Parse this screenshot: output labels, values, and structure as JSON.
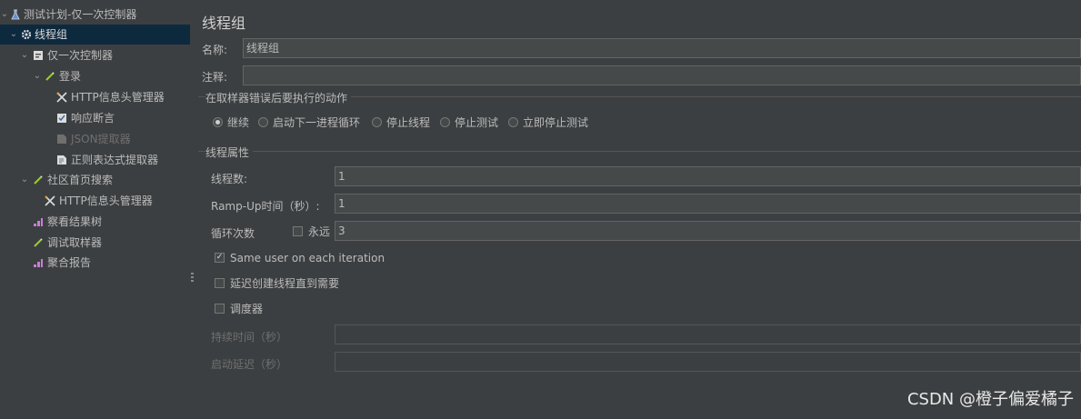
{
  "tree": {
    "items": [
      {
        "label": "测试计划-仅一次控制器",
        "icon": "flask-icon"
      },
      {
        "label": "线程组",
        "icon": "gear-icon"
      },
      {
        "label": "仅一次控制器",
        "icon": "controller-icon"
      },
      {
        "label": "登录",
        "icon": "sampler-pen-icon"
      },
      {
        "label": "HTTP信息头管理器",
        "icon": "wrench-icon"
      },
      {
        "label": "响应断言",
        "icon": "assertion-icon"
      },
      {
        "label": "JSON提取器",
        "icon": "extractor-icon"
      },
      {
        "label": "正则表达式提取器",
        "icon": "regex-extractor-icon"
      },
      {
        "label": "社区首页搜索",
        "icon": "sampler-pen-icon"
      },
      {
        "label": "HTTP信息头管理器",
        "icon": "wrench-icon"
      },
      {
        "label": "察看结果树",
        "icon": "listener-chart-icon"
      },
      {
        "label": "调试取样器",
        "icon": "sampler-pen-icon"
      },
      {
        "label": "聚合报告",
        "icon": "listener-chart-icon"
      }
    ]
  },
  "panel": {
    "title": "线程组",
    "name_label": "名称:",
    "name_value": "线程组",
    "comment_label": "注释:",
    "comment_value": "",
    "error_group_title": "在取样器错误后要执行的动作",
    "error_options": [
      "继续",
      "启动下一进程循环",
      "停止线程",
      "停止测试",
      "立即停止测试"
    ],
    "error_selected": "继续",
    "thread_group_title": "线程属性",
    "threads_label": "线程数:",
    "threads_value": "1",
    "rampup_label": "Ramp-Up时间（秒）:",
    "rampup_value": "1",
    "loop_label": "循环次数",
    "forever_label": "永远",
    "forever_checked": false,
    "loop_value": "3",
    "same_user_label": "Same user on each iteration",
    "same_user_checked": true,
    "delay_label": "延迟创建线程直到需要",
    "delay_checked": false,
    "scheduler_label": "调度器",
    "scheduler_checked": false,
    "duration_label": "持续时间（秒）",
    "startup_delay_label": "启动延迟（秒）"
  },
  "watermark": "CSDN @橙子偏爱橘子"
}
